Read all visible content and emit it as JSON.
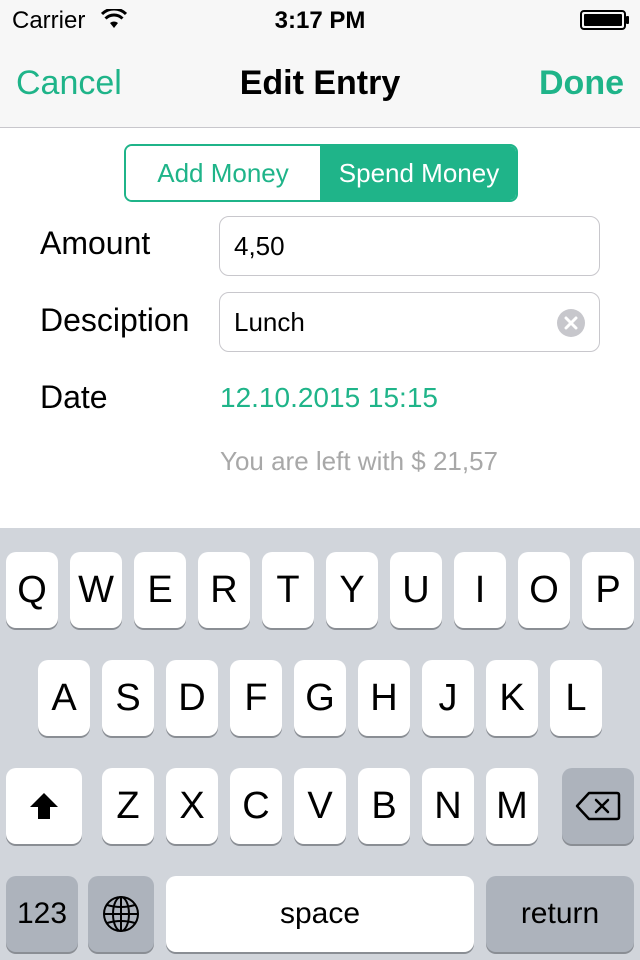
{
  "status_bar": {
    "carrier": "Carrier",
    "time": "3:17 PM",
    "icons": [
      "wifi-icon",
      "battery-icon"
    ]
  },
  "nav_bar": {
    "cancel_label": "Cancel",
    "title": "Edit Entry",
    "done_label": "Done"
  },
  "segmented": {
    "options": [
      "Add Money",
      "Spend Money"
    ],
    "selected": "Spend Money"
  },
  "form": {
    "amount_label": "Amount",
    "amount_value": "4,50",
    "description_label": "Desciption",
    "description_value": "Lunch",
    "date_label": "Date",
    "date_value": "12.10.2015 15:15",
    "balance_note": "You are left with $ 21,57"
  },
  "keyboard": {
    "row1": [
      "Q",
      "W",
      "E",
      "R",
      "T",
      "Y",
      "U",
      "I",
      "O",
      "P"
    ],
    "row2": [
      "A",
      "S",
      "D",
      "F",
      "G",
      "H",
      "J",
      "K",
      "L"
    ],
    "row3": [
      "Z",
      "X",
      "C",
      "V",
      "B",
      "N",
      "M"
    ],
    "numbers_label": "123",
    "space_label": "space",
    "return_label": "return",
    "icons": [
      "shift-icon",
      "backspace-icon",
      "globe-icon"
    ]
  },
  "colors": {
    "accent": "#1fb489",
    "keyboard_bg": "#d1d5db",
    "placeholder_gray": "#a8a8a8"
  }
}
